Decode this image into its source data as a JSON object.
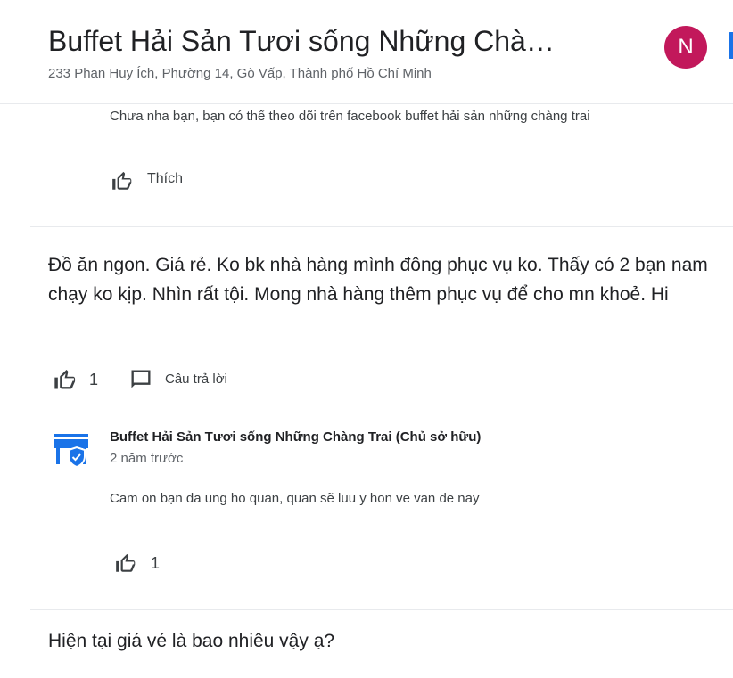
{
  "header": {
    "title": "Buffet Hải Sản Tươi sống Những Chà…",
    "address": "233 Phan Huy Ích, Phường 14, Gò Vấp, Thành phố Hồ Chí Minh",
    "avatar_letter": "N",
    "colors": {
      "avatar_bg": "#c2185b",
      "accent": "#1a73e8"
    }
  },
  "reply1": {
    "text": "Chưa nha bạn, bạn có thể theo dõi trên facebook buffet hải sản những chàng trai",
    "like_label": "Thích",
    "like_icon": "thumbs-up-icon"
  },
  "review": {
    "text": "Đồ ăn ngon. Giá rẻ. Ko bk nhà hàng mình đông phục vụ ko. Thấy có 2 bạn nam chạy ko kịp. Nhìn rất tội. Mong nhà hàng thêm phục vụ để cho mn khoẻ. Hi",
    "like_count": "1",
    "reply_label": "Câu trả lời",
    "reply_icon": "comment-icon"
  },
  "owner_reply": {
    "name": "Buffet Hải Sản Tươi sống Những Chàng Trai (Chủ sở hữu)",
    "time": "2 năm trước",
    "text": "Cam on bạn da ung ho quan, quan sẽ luu y hon ve van de nay",
    "like_count": "1",
    "icon": "verified-store-icon"
  },
  "next_question": {
    "text": "Hiện tại giá vé là bao nhiêu vậy ạ?"
  }
}
